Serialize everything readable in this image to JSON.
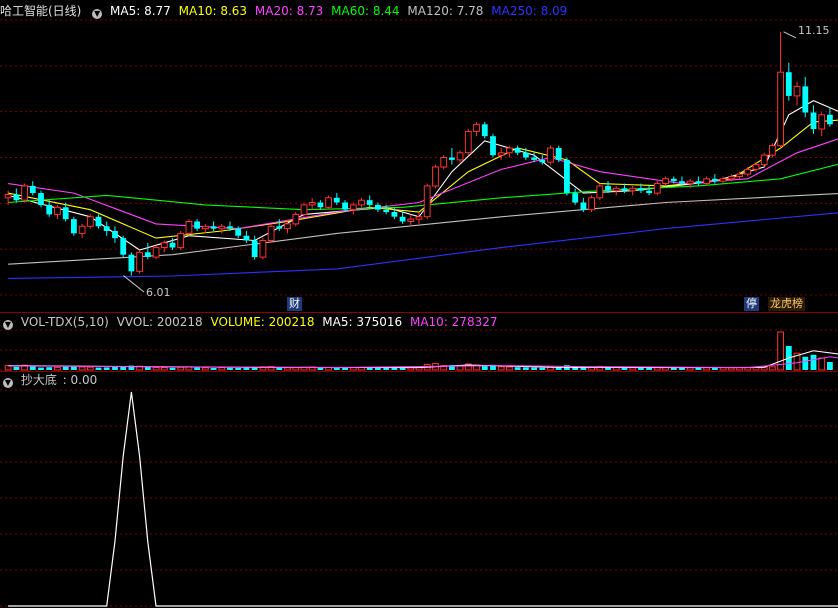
{
  "stock": {
    "title": "哈工智能(日线)"
  },
  "price_header": {
    "ma5": "MA5: 8.77",
    "ma10": "MA10: 8.63",
    "ma20": "MA20: 8.73",
    "ma60": "MA60: 8.44",
    "ma120": "MA120: 7.78",
    "ma250": "MA250: 8.09"
  },
  "volume_header": {
    "name": "VOL-TDX(5,10)",
    "vvol": "VVOL: 200218",
    "volume": "VOLUME: 200218",
    "ma5": "MA5: 375016",
    "ma10": "MA10: 278327"
  },
  "indicator_header": {
    "name": "抄大底",
    "value": ": 0.00"
  },
  "annotations": {
    "high": "11.15",
    "low": "6.01",
    "fin": "财",
    "limit_up": "停",
    "lhb": "龙虎榜"
  },
  "colors": {
    "up": "#ff3030",
    "down": "#00ffff",
    "ma5": "#ffffff",
    "ma10": "#ffff00",
    "ma20": "#ff40ff",
    "ma60": "#00ff00",
    "ma120": "#c0c0c0",
    "ma250": "#3030ff",
    "grid": "#800000",
    "label": "#c8c8c8"
  },
  "chart_data": [
    {
      "type": "candlestick",
      "title": "哈工智能(日线)",
      "ylim": [
        5.6,
        11.4
      ],
      "annotations": {
        "high": 11.15,
        "low": 6.01
      },
      "candles": [
        [
          7.65,
          7.8,
          7.5,
          7.72
        ],
        [
          7.72,
          7.85,
          7.55,
          7.6
        ],
        [
          7.6,
          7.95,
          7.55,
          7.9
        ],
        [
          7.9,
          8.0,
          7.7,
          7.75
        ],
        [
          7.75,
          7.8,
          7.45,
          7.5
        ],
        [
          7.5,
          7.6,
          7.25,
          7.3
        ],
        [
          7.3,
          7.5,
          7.2,
          7.45
        ],
        [
          7.45,
          7.55,
          7.15,
          7.2
        ],
        [
          7.2,
          7.25,
          6.85,
          6.9
        ],
        [
          6.9,
          7.1,
          6.8,
          7.05
        ],
        [
          7.05,
          7.3,
          7.0,
          7.25
        ],
        [
          7.25,
          7.3,
          7.0,
          7.05
        ],
        [
          7.05,
          7.15,
          6.85,
          6.95
        ],
        [
          6.95,
          7.05,
          6.7,
          6.8
        ],
        [
          6.8,
          6.85,
          6.4,
          6.45
        ],
        [
          6.45,
          6.5,
          6.01,
          6.1
        ],
        [
          6.1,
          6.55,
          6.05,
          6.5
        ],
        [
          6.5,
          6.7,
          6.35,
          6.4
        ],
        [
          6.4,
          6.65,
          6.35,
          6.6
        ],
        [
          6.6,
          6.75,
          6.5,
          6.7
        ],
        [
          6.7,
          6.8,
          6.55,
          6.6
        ],
        [
          6.6,
          6.95,
          6.55,
          6.9
        ],
        [
          6.9,
          7.2,
          6.85,
          7.15
        ],
        [
          7.15,
          7.2,
          6.95,
          7.0
        ],
        [
          7.0,
          7.1,
          6.9,
          7.05
        ],
        [
          7.05,
          7.15,
          6.95,
          7.0
        ],
        [
          7.0,
          7.1,
          6.9,
          7.05
        ],
        [
          7.05,
          7.15,
          6.95,
          7.0
        ],
        [
          7.0,
          7.05,
          6.8,
          6.85
        ],
        [
          6.85,
          6.95,
          6.7,
          6.75
        ],
        [
          6.75,
          6.85,
          6.35,
          6.4
        ],
        [
          6.4,
          6.8,
          6.35,
          6.75
        ],
        [
          6.75,
          7.1,
          6.7,
          7.05
        ],
        [
          7.05,
          7.2,
          6.95,
          7.0
        ],
        [
          7.0,
          7.15,
          6.9,
          7.1
        ],
        [
          7.1,
          7.35,
          7.05,
          7.3
        ],
        [
          7.3,
          7.55,
          7.25,
          7.5
        ],
        [
          7.5,
          7.65,
          7.4,
          7.55
        ],
        [
          7.55,
          7.6,
          7.4,
          7.45
        ],
        [
          7.45,
          7.7,
          7.4,
          7.65
        ],
        [
          7.65,
          7.75,
          7.5,
          7.55
        ],
        [
          7.55,
          7.6,
          7.35,
          7.4
        ],
        [
          7.4,
          7.55,
          7.3,
          7.5
        ],
        [
          7.5,
          7.65,
          7.45,
          7.6
        ],
        [
          7.6,
          7.7,
          7.45,
          7.5
        ],
        [
          7.5,
          7.55,
          7.35,
          7.4
        ],
        [
          7.4,
          7.5,
          7.3,
          7.35
        ],
        [
          7.35,
          7.45,
          7.2,
          7.25
        ],
        [
          7.25,
          7.35,
          7.1,
          7.15
        ],
        [
          7.15,
          7.3,
          7.05,
          7.2
        ],
        [
          7.2,
          7.35,
          7.1,
          7.25
        ],
        [
          7.25,
          7.95,
          7.2,
          7.9
        ],
        [
          7.9,
          8.35,
          7.85,
          8.3
        ],
        [
          8.3,
          8.55,
          8.25,
          8.5
        ],
        [
          8.5,
          8.7,
          8.35,
          8.45
        ],
        [
          8.45,
          8.65,
          8.4,
          8.6
        ],
        [
          8.6,
          9.1,
          8.55,
          9.05
        ],
        [
          9.05,
          9.25,
          8.95,
          9.2
        ],
        [
          9.2,
          9.25,
          8.9,
          8.95
        ],
        [
          8.95,
          9.0,
          8.5,
          8.55
        ],
        [
          8.55,
          8.7,
          8.45,
          8.6
        ],
        [
          8.6,
          8.75,
          8.5,
          8.7
        ],
        [
          8.7,
          8.75,
          8.55,
          8.6
        ],
        [
          8.6,
          8.7,
          8.45,
          8.5
        ],
        [
          8.5,
          8.6,
          8.4,
          8.45
        ],
        [
          8.45,
          8.55,
          8.35,
          8.4
        ],
        [
          8.4,
          8.75,
          8.35,
          8.7
        ],
        [
          8.7,
          8.75,
          8.4,
          8.45
        ],
        [
          8.45,
          8.5,
          7.7,
          7.75
        ],
        [
          7.75,
          7.85,
          7.5,
          7.55
        ],
        [
          7.55,
          7.65,
          7.35,
          7.4
        ],
        [
          7.4,
          7.7,
          7.35,
          7.65
        ],
        [
          7.65,
          7.95,
          7.6,
          7.9
        ],
        [
          7.9,
          8.0,
          7.75,
          7.8
        ],
        [
          7.8,
          7.9,
          7.7,
          7.85
        ],
        [
          7.85,
          7.95,
          7.75,
          7.8
        ],
        [
          7.8,
          7.9,
          7.7,
          7.85
        ],
        [
          7.85,
          7.95,
          7.75,
          7.8
        ],
        [
          7.8,
          7.9,
          7.7,
          7.75
        ],
        [
          7.75,
          8.0,
          7.7,
          7.95
        ],
        [
          7.95,
          8.1,
          7.9,
          8.05
        ],
        [
          8.05,
          8.1,
          7.95,
          8.0
        ],
        [
          8.0,
          8.1,
          7.9,
          7.95
        ],
        [
          7.95,
          8.05,
          7.85,
          8.0
        ],
        [
          8.0,
          8.1,
          7.9,
          7.95
        ],
        [
          7.95,
          8.1,
          7.9,
          8.05
        ],
        [
          8.05,
          8.15,
          7.95,
          8.0
        ],
        [
          8.0,
          8.1,
          7.95,
          8.05
        ],
        [
          8.05,
          8.15,
          8.0,
          8.1
        ],
        [
          8.1,
          8.2,
          8.05,
          8.15
        ],
        [
          8.15,
          8.3,
          8.1,
          8.25
        ],
        [
          8.25,
          8.4,
          8.2,
          8.35
        ],
        [
          8.35,
          8.6,
          8.3,
          8.55
        ],
        [
          8.55,
          8.8,
          8.5,
          8.75
        ],
        [
          8.75,
          11.15,
          8.7,
          10.3
        ],
        [
          10.3,
          10.5,
          9.7,
          9.8
        ],
        [
          9.8,
          10.1,
          9.6,
          10.0
        ],
        [
          10.0,
          10.2,
          9.35,
          9.45
        ],
        [
          9.45,
          9.6,
          9.0,
          9.1
        ],
        [
          9.1,
          9.45,
          8.95,
          9.4
        ],
        [
          9.4,
          9.55,
          9.15,
          9.2
        ]
      ],
      "ma": {
        "MA5": [
          [
            0,
            7.7
          ],
          [
            10,
            7.25
          ],
          [
            16,
            6.55
          ],
          [
            22,
            6.85
          ],
          [
            30,
            6.75
          ],
          [
            36,
            7.3
          ],
          [
            46,
            7.45
          ],
          [
            50,
            7.25
          ],
          [
            54,
            8.2
          ],
          [
            58,
            8.85
          ],
          [
            64,
            8.55
          ],
          [
            70,
            7.75
          ],
          [
            76,
            7.8
          ],
          [
            86,
            8.0
          ],
          [
            92,
            8.3
          ],
          [
            95,
            9.4
          ],
          [
            98,
            9.7
          ],
          [
            102,
            9.4
          ]
        ],
        "MA10": [
          [
            0,
            7.75
          ],
          [
            10,
            7.4
          ],
          [
            18,
            6.8
          ],
          [
            26,
            6.95
          ],
          [
            34,
            7.15
          ],
          [
            44,
            7.45
          ],
          [
            50,
            7.35
          ],
          [
            56,
            8.2
          ],
          [
            62,
            8.7
          ],
          [
            68,
            8.45
          ],
          [
            72,
            7.95
          ],
          [
            80,
            7.9
          ],
          [
            88,
            8.05
          ],
          [
            94,
            8.7
          ],
          [
            98,
            9.25
          ],
          [
            102,
            9.3
          ]
        ],
        "MA20": [
          [
            0,
            7.95
          ],
          [
            8,
            7.75
          ],
          [
            18,
            7.1
          ],
          [
            28,
            7.0
          ],
          [
            40,
            7.35
          ],
          [
            50,
            7.55
          ],
          [
            60,
            8.25
          ],
          [
            66,
            8.5
          ],
          [
            72,
            8.2
          ],
          [
            82,
            7.95
          ],
          [
            90,
            8.05
          ],
          [
            96,
            8.6
          ],
          [
            102,
            8.95
          ]
        ],
        "MA60": [
          [
            0,
            7.55
          ],
          [
            12,
            7.7
          ],
          [
            24,
            7.5
          ],
          [
            36,
            7.4
          ],
          [
            48,
            7.45
          ],
          [
            60,
            7.65
          ],
          [
            72,
            7.8
          ],
          [
            84,
            7.9
          ],
          [
            94,
            8.05
          ],
          [
            102,
            8.4
          ]
        ],
        "MA120": [
          [
            0,
            6.25
          ],
          [
            20,
            6.45
          ],
          [
            40,
            6.9
          ],
          [
            60,
            7.25
          ],
          [
            80,
            7.55
          ],
          [
            102,
            7.75
          ]
        ],
        "MA250": [
          [
            0,
            5.95
          ],
          [
            20,
            6.0
          ],
          [
            40,
            6.15
          ],
          [
            60,
            6.6
          ],
          [
            80,
            7.0
          ],
          [
            102,
            7.35
          ]
        ]
      }
    },
    {
      "type": "bar",
      "title": "VOL-TDX(5,10)",
      "ylim": [
        0,
        1000000
      ],
      "values": [
        110000,
        80000,
        120000,
        90000,
        60000,
        70000,
        65000,
        85000,
        100000,
        75000,
        70000,
        60000,
        65000,
        80000,
        90000,
        110000,
        95000,
        70000,
        65000,
        60000,
        55000,
        70000,
        80000,
        60000,
        55000,
        50000,
        60000,
        55000,
        50000,
        60000,
        70000,
        80000,
        85000,
        60000,
        55000,
        60000,
        70000,
        75000,
        60000,
        65000,
        60000,
        55000,
        60000,
        65000,
        55000,
        50000,
        55000,
        60000,
        50000,
        55000,
        60000,
        140000,
        160000,
        110000,
        120000,
        100000,
        150000,
        120000,
        110000,
        130000,
        80000,
        75000,
        70000,
        65000,
        60000,
        55000,
        75000,
        70000,
        120000,
        90000,
        80000,
        75000,
        90000,
        70000,
        65000,
        60000,
        55000,
        60000,
        55000,
        60000,
        65000,
        60000,
        55000,
        55000,
        50000,
        55000,
        60000,
        55000,
        50000,
        55000,
        60000,
        65000,
        70000,
        80000,
        950000,
        600000,
        420000,
        330000,
        380000,
        300000,
        200218
      ],
      "ma5_values": [
        [
          0,
          110000
        ],
        [
          16,
          85000
        ],
        [
          30,
          65000
        ],
        [
          50,
          60000
        ],
        [
          56,
          125000
        ],
        [
          66,
          70000
        ],
        [
          80,
          60000
        ],
        [
          92,
          65000
        ],
        [
          95,
          300000
        ],
        [
          98,
          480000
        ],
        [
          102,
          375016
        ]
      ],
      "ma10_values": [
        [
          0,
          100000
        ],
        [
          20,
          80000
        ],
        [
          40,
          62000
        ],
        [
          52,
          90000
        ],
        [
          60,
          110000
        ],
        [
          70,
          85000
        ],
        [
          90,
          60000
        ],
        [
          96,
          180000
        ],
        [
          100,
          330000
        ],
        [
          102,
          278327
        ]
      ]
    },
    {
      "type": "line",
      "title": "抄大底",
      "ylim": [
        0,
        1
      ],
      "x": [
        0,
        12,
        13,
        14,
        15,
        16,
        17,
        18,
        102
      ],
      "values": [
        0,
        0,
        0.3,
        0.7,
        1.0,
        0.7,
        0.3,
        0,
        0
      ]
    }
  ]
}
